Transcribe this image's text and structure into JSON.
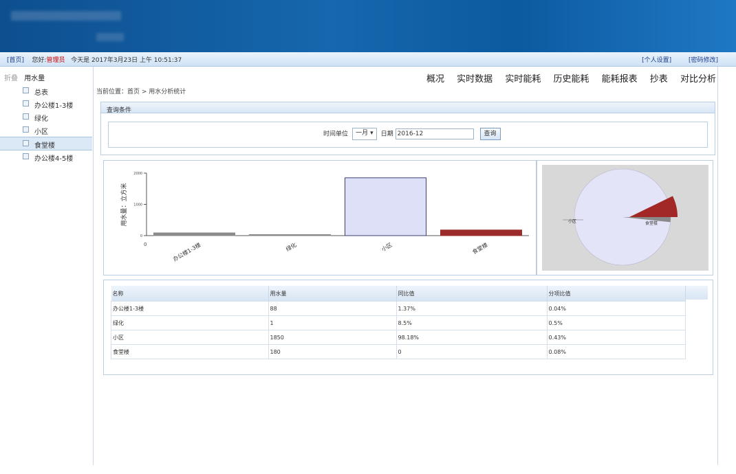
{
  "status_bar": {
    "home_link": "[首页]",
    "prefix": "您好:",
    "user": "管理员",
    "today_text": "今天是 2017年3月23日 上午 10:51:37",
    "personal_link": "[个人设置]",
    "password_link": "[密码修改]"
  },
  "sidebar": {
    "toggle": "折叠",
    "root": "用水量",
    "items": [
      {
        "label": "总表"
      },
      {
        "label": "办公楼1-3楼"
      },
      {
        "label": "绿化"
      },
      {
        "label": "小区"
      },
      {
        "label": "食堂楼"
      },
      {
        "label": "办公楼4-5楼"
      }
    ]
  },
  "top_nav": [
    "概况",
    "实时数据",
    "实时能耗",
    "历史能耗",
    "能耗报表",
    "抄表",
    "对比分析"
  ],
  "breadcrumb": "当前位置：首页 > 用水分析统计",
  "query_panel": {
    "title": "查询条件",
    "unit_label": "时间单位",
    "unit_value": "一月",
    "date_label": "日期",
    "date_value": "2016-12",
    "query_button": "查询"
  },
  "chart_data": {
    "type": "bar",
    "categories": [
      "办公楼1-3楼",
      "绿化",
      "小区",
      "食堂楼"
    ],
    "values": [
      88,
      1,
      1850,
      180
    ],
    "colors": [
      "#8a8a8a",
      "#8a8a8a",
      "#dde0f6",
      "#9c2b2b"
    ],
    "ylabel": "用水量：立方米",
    "ylim": [
      0,
      2000
    ],
    "yticks": [
      0,
      1000,
      2000
    ],
    "x_origin_label": "0"
  },
  "pie_chart": {
    "type": "pie",
    "slices": [
      {
        "label": "小区",
        "value": 0.842,
        "color": "#e3e4f7"
      },
      {
        "label": "食堂楼",
        "value": 0.082,
        "color": "#a22828"
      },
      {
        "label": "办公楼1-3楼",
        "value": 0.04,
        "color": "#8a8a8a"
      }
    ],
    "label_left": "小区",
    "label_right": "食堂楼"
  },
  "table": {
    "headers": [
      "名称",
      "用水量",
      "同比值",
      "分项比值"
    ],
    "rows": [
      [
        "办公楼1-3楼",
        "88",
        "1.37%",
        "0.04%"
      ],
      [
        "绿化",
        "1",
        "8.5%",
        "0.5%"
      ],
      [
        "小区",
        "1850",
        "98.18%",
        "0.43%"
      ],
      [
        "食堂楼",
        "180",
        "0",
        "0.08%"
      ]
    ]
  }
}
